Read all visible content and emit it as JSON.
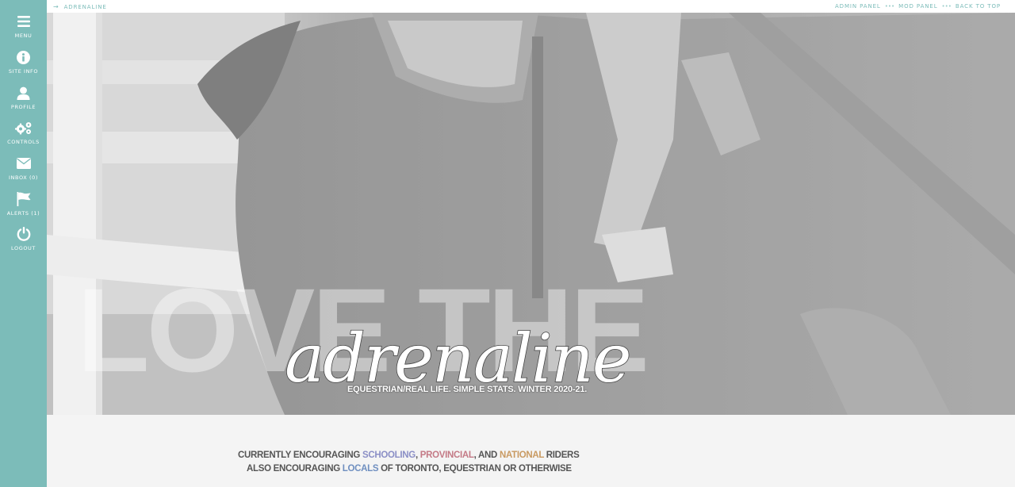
{
  "sidebar": {
    "items": [
      {
        "label": "MENU",
        "icon": "menu-icon"
      },
      {
        "label": "SITE INFO",
        "icon": "info-icon"
      },
      {
        "label": "PROFILE",
        "icon": "user-icon"
      },
      {
        "label": "CONTROLS",
        "icon": "gears-icon"
      },
      {
        "label": "INBOX (0)",
        "icon": "envelope-icon"
      },
      {
        "label": "ALERTS (1)",
        "icon": "flag-icon"
      },
      {
        "label": "LOGOUT",
        "icon": "power-icon"
      }
    ]
  },
  "topbar": {
    "breadcrumb": "ADRENALINE",
    "links": [
      "ADMIN PANEL",
      "MOD PANEL",
      "BACK TO TOP"
    ],
    "separator": "•••"
  },
  "hero": {
    "headline": "LOVE THE",
    "script_word": "adrenaline",
    "tagline": "EQUESTRIAN/REAL LIFE. SIMPLE STATS. WINTER 2020-21."
  },
  "content": {
    "line1": {
      "prefix": "CURRENTLY ENCOURAGING ",
      "schooling": "SCHOOLING",
      "comma": ", ",
      "provincial": "PROVINCIAL",
      "and": ", AND ",
      "national": "NATIONAL",
      "suffix": " RIDERS"
    },
    "line2": {
      "prefix": "ALSO ENCOURAGING ",
      "locals": "LOCALS",
      "suffix": " OF TORONTO, EQUESTRIAN OR OTHERWISE"
    }
  },
  "colors": {
    "accent": "#7cbcb9",
    "schooling": "#8b8fc6",
    "provincial": "#c47a86",
    "national": "#c99a62",
    "locals": "#6f8fc0"
  }
}
